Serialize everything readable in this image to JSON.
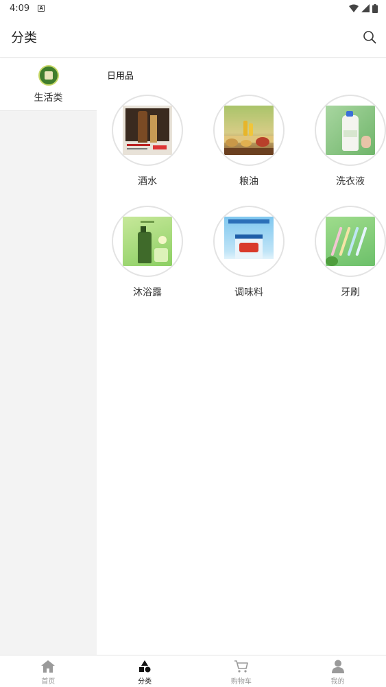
{
  "status_bar": {
    "time": "4:09",
    "notification_icon": "A"
  },
  "app_bar": {
    "title": "分类",
    "search_icon": "search-icon"
  },
  "sidebar": {
    "items": [
      {
        "label": "生活类",
        "selected": true
      }
    ]
  },
  "main": {
    "section_title": "日用品",
    "items": [
      {
        "label": "酒水"
      },
      {
        "label": "粮油"
      },
      {
        "label": "洗衣液"
      },
      {
        "label": "沐浴露"
      },
      {
        "label": "调味料"
      },
      {
        "label": "牙刷"
      }
    ]
  },
  "tab_bar": {
    "tabs": [
      {
        "label": "首页",
        "icon": "home-icon",
        "active": false
      },
      {
        "label": "分类",
        "icon": "category-icon",
        "active": true
      },
      {
        "label": "购物车",
        "icon": "cart-icon",
        "active": false
      },
      {
        "label": "我的",
        "icon": "person-icon",
        "active": false
      }
    ]
  },
  "colors": {
    "active_tab": "#111111",
    "inactive_tab": "#999999",
    "sidebar_bg": "#f3f3f3"
  }
}
